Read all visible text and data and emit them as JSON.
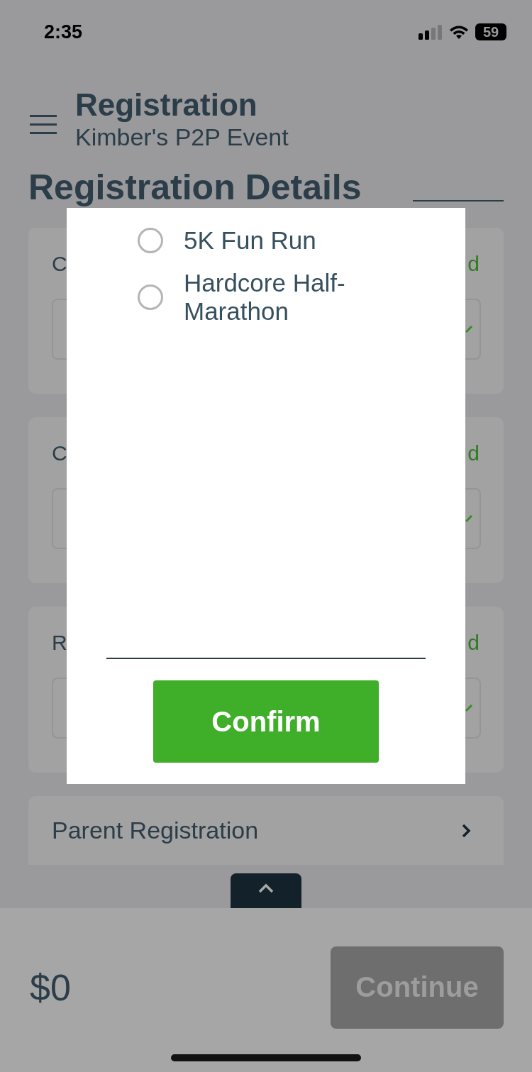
{
  "status_bar": {
    "time": "2:35",
    "battery": "59"
  },
  "header": {
    "title": "Registration",
    "subtitle": "Kimber's P2P Event"
  },
  "section_title": "Registration Details",
  "cards": [
    {
      "label": "C",
      "status": "d"
    },
    {
      "label": "C",
      "status": "d"
    },
    {
      "label": "R",
      "status": "d"
    }
  ],
  "parent_registration": {
    "label": "Parent Registration"
  },
  "footer": {
    "total": "$0",
    "continue": {
      "label": "Continue",
      "disabled": true
    }
  },
  "dialog": {
    "options": [
      {
        "label": "5K Fun Run",
        "selected": false
      },
      {
        "label": "Hardcore Half-Marathon",
        "selected": false
      }
    ],
    "confirm": "Confirm"
  }
}
